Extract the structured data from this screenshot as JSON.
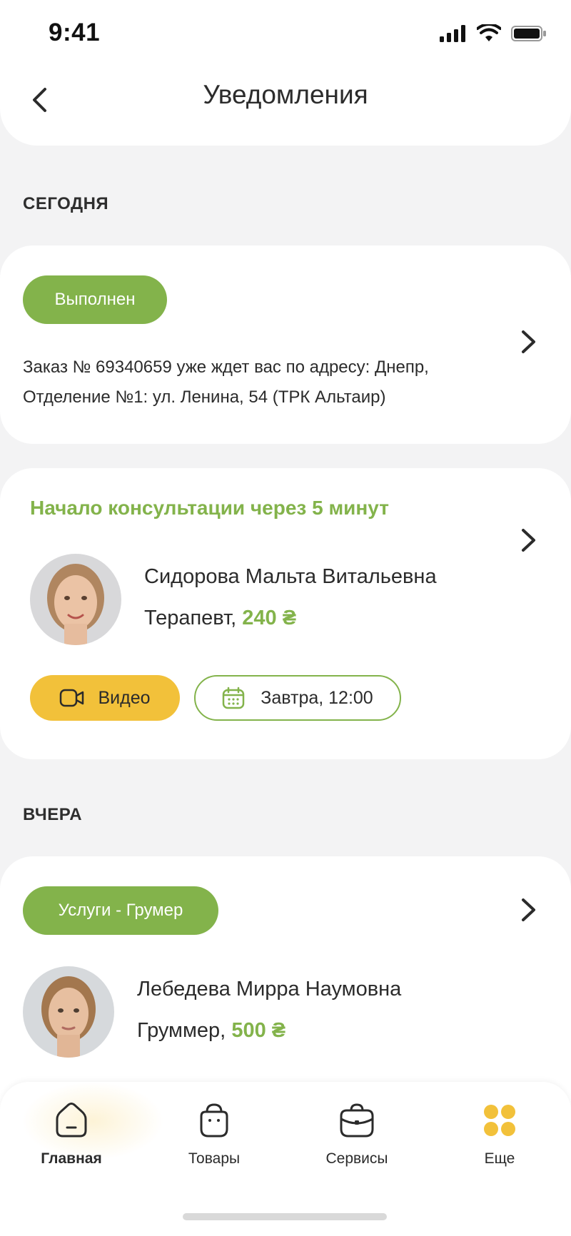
{
  "status_bar": {
    "time": "9:41"
  },
  "header": {
    "title": "Уведомления"
  },
  "sections": {
    "today": "СЕГОДНЯ",
    "yesterday": "ВЧЕРА"
  },
  "order_card": {
    "badge": "Выполнен",
    "text": "Заказ № 69340659 уже ждет вас по адресу: Днепр, Отделение №1: ул. Ленина, 54 (ТРК Альтаир)"
  },
  "consult_card": {
    "title": "Начало консультации через 5 минут",
    "doctor_name": "Сидорова Мальта Витальевна",
    "role": "Терапевт,",
    "price": "240 ₴",
    "video_label": "Видео",
    "date_label": "Завтра, 12:00"
  },
  "groomer_card": {
    "badge": "Услуги - Грумер",
    "name": "Лебедева Мирра Наумовна",
    "role": "Груммер,",
    "price": "500 ₴"
  },
  "nav": {
    "items": [
      {
        "label": "Главная",
        "icon": "home-icon",
        "active": true
      },
      {
        "label": "Товары",
        "icon": "bag-icon"
      },
      {
        "label": "Сервисы",
        "icon": "briefcase-icon"
      },
      {
        "label": "Еще",
        "icon": "more-dots-icon"
      }
    ]
  },
  "colors": {
    "accent_green": "#83B34B",
    "accent_yellow": "#F2C13A",
    "background": "#F3F3F4"
  }
}
